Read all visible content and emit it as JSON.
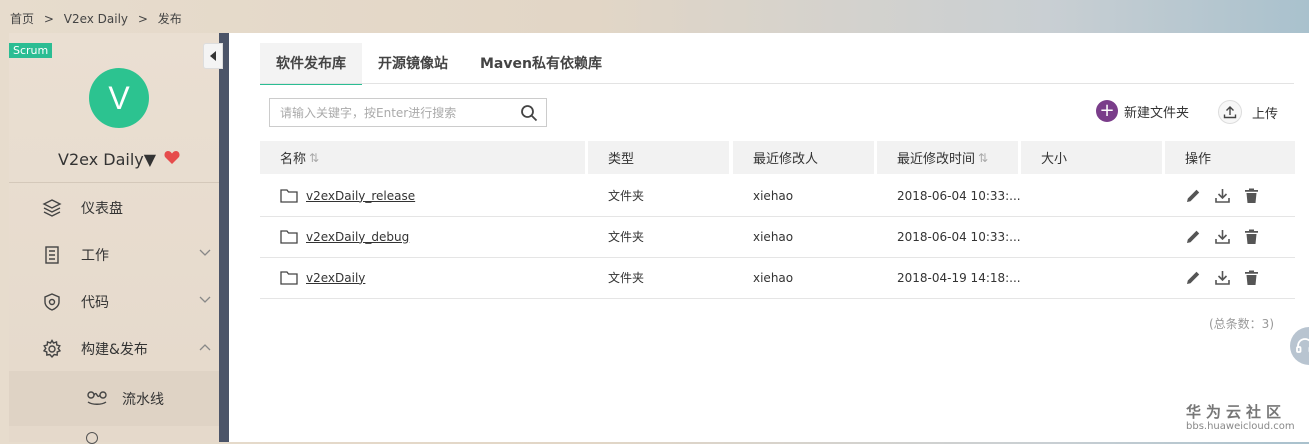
{
  "breadcrumb": {
    "items": [
      "首页",
      "V2ex Daily",
      "发布"
    ],
    "separator": ">"
  },
  "sidebar": {
    "badge": "Scrum",
    "avatar_letter": "V",
    "project_name": "V2ex Daily▼",
    "items": [
      {
        "label": "仪表盘",
        "icon": "layers-icon"
      },
      {
        "label": "工作",
        "icon": "document-list-icon",
        "expandable": true
      },
      {
        "label": "代码",
        "icon": "shield-code-icon",
        "expandable": true
      },
      {
        "label": "构建&发布",
        "icon": "gear-icon",
        "expandable": true,
        "expanded": true
      }
    ],
    "sub_items": [
      {
        "label": "流水线",
        "icon": "pipeline-icon"
      }
    ]
  },
  "tabs": [
    {
      "label": "软件发布库",
      "active": true
    },
    {
      "label": "开源镜像站",
      "active": false
    },
    {
      "label": "Maven私有依赖库",
      "active": false
    }
  ],
  "search": {
    "placeholder": "请输入关键字，按Enter进行搜索"
  },
  "toolbar": {
    "new_folder_label": "新建文件夹",
    "upload_label": "上传"
  },
  "table": {
    "headers": [
      "名称",
      "类型",
      "最近修改人",
      "最近修改时间",
      "大小",
      "操作"
    ],
    "rows": [
      {
        "name": "v2exDaily_release",
        "type": "文件夹",
        "modifier": "xiehao",
        "modified": "2018-06-04 10:33:...",
        "size": ""
      },
      {
        "name": "v2exDaily_debug",
        "type": "文件夹",
        "modifier": "xiehao",
        "modified": "2018-06-04 10:33:...",
        "size": ""
      },
      {
        "name": "v2exDaily",
        "type": "文件夹",
        "modifier": "xiehao",
        "modified": "2018-04-19 14:18:...",
        "size": ""
      }
    ]
  },
  "total": "(总条数：3)",
  "watermark": {
    "title": "华为云社区",
    "url": "bbs.huaweicloud.com"
  },
  "colors": {
    "accent": "#2bbd93",
    "avatar": "#2cc390",
    "new_button": "#7a3d8a",
    "sidebar_edge": "#4b5468",
    "heart": "#e64c4c"
  }
}
